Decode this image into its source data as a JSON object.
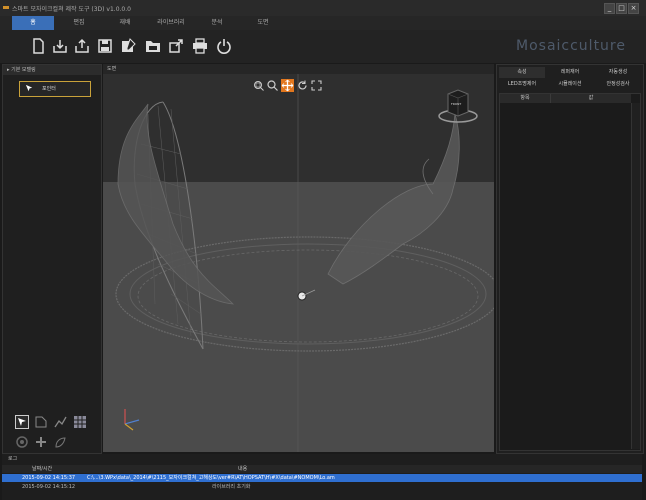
{
  "window": {
    "title": "스마트 모자이크컬쳐 제작 도구 (3D) v1.0.0.0",
    "controls": {
      "minimize": "_",
      "maximize": "□",
      "close": "×"
    }
  },
  "menu": [
    {
      "label": "홈",
      "active": true
    },
    {
      "label": "편집",
      "active": false
    },
    {
      "label": "재배",
      "active": false
    },
    {
      "label": "라이브러리",
      "active": false
    },
    {
      "label": "분석",
      "active": false
    },
    {
      "label": "도면",
      "active": false
    }
  ],
  "toolbar_icons": [
    "new-file-icon",
    "open-icon",
    "import-icon",
    "save-icon",
    "save-as-icon",
    "folder-icon",
    "export-icon",
    "print-icon",
    "power-icon"
  ],
  "brand": "Mosaicculture",
  "left_panel": {
    "title": "기본 모델링",
    "pointer_label": "포인터",
    "bottom_tools": [
      "select-icon",
      "shape-icon",
      "chart-icon",
      "grid-icon",
      "flower-icon",
      "plus-icon",
      "leaf-icon"
    ]
  },
  "viewport": {
    "title": "도면",
    "view_tools": [
      "zoom-region-icon",
      "zoom-icon",
      "pan-icon",
      "rotate-icon",
      "fit-icon"
    ],
    "nav_cube_label": "FRONT"
  },
  "right_panel": {
    "tabs_row1": [
      "속성",
      "레퍼재어",
      "자동생성"
    ],
    "tabs_row2": [
      "LED조명제어",
      "시뮬레이션",
      "안정성검사"
    ],
    "columns": [
      "항목",
      "값"
    ]
  },
  "log": {
    "title": "로그",
    "columns": [
      "날짜/시간",
      "내용"
    ],
    "rows": [
      {
        "time": "2015-09-02 14:15:37",
        "content": "C:\\...\\3.WPx\\data\\_2014\\#\\2115_모자이크컬쳐_고해상도\\ver#R\\AT\\HOPSAT\\H\\#X\\data\\#NOMOM\\Lo.am",
        "selected": true
      },
      {
        "time": "2015-09-02 14:15:12",
        "content": "라이브러리 초기화",
        "selected": false
      }
    ]
  },
  "colors": {
    "accent": "#3a6fb8",
    "highlight": "#e2771e",
    "pointer_border": "#c9a23a"
  }
}
